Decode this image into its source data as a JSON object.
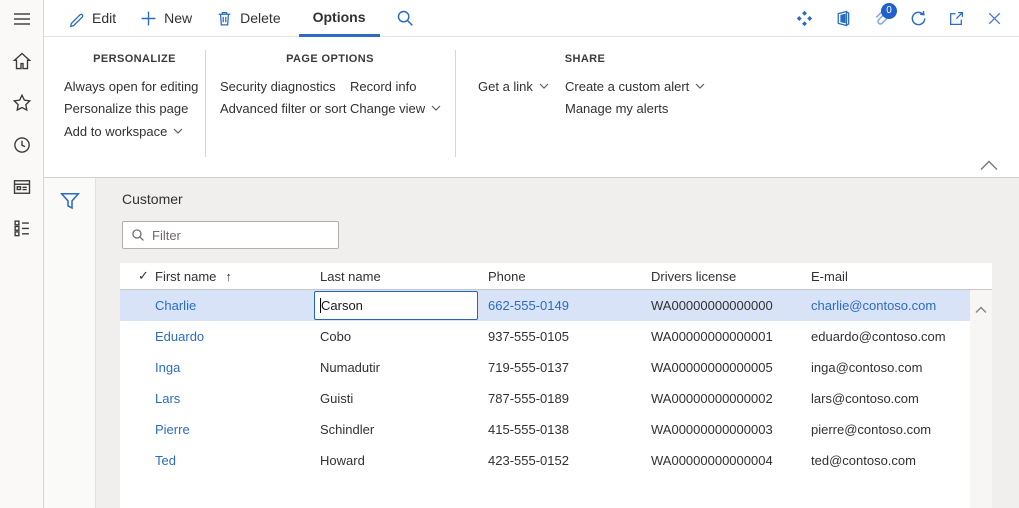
{
  "colors": {
    "accent": "#2b6cc3",
    "link": "#2b6cc3",
    "selected_row_bg": "#d8e3f8",
    "badge": "#2160c8"
  },
  "sidebar": {
    "icons": [
      "hamburger-menu",
      "home",
      "favorites",
      "recent",
      "page",
      "modules"
    ]
  },
  "command_bar": {
    "edit": "Edit",
    "new": "New",
    "delete": "Delete",
    "options_tab": "Options",
    "attachments_count": "0",
    "right_icons": [
      "diamond-grid",
      "office",
      "attachments",
      "refresh",
      "open-in-new-window",
      "close"
    ]
  },
  "ribbon": {
    "sections": [
      {
        "title": "PERSONALIZE",
        "columns": [
          [
            {
              "label": "Always open for editing"
            },
            {
              "label": "Personalize this page"
            },
            {
              "label": "Add to workspace",
              "chevron": true
            }
          ]
        ]
      },
      {
        "title": "PAGE OPTIONS",
        "columns": [
          [
            {
              "label": "Security diagnostics"
            },
            {
              "label": "Advanced filter or sort"
            }
          ],
          [
            {
              "label": "Record info"
            },
            {
              "label": "Change view",
              "chevron": true
            }
          ]
        ]
      },
      {
        "title": "SHARE",
        "columns": [
          [
            {
              "label": "Get a link",
              "chevron": true
            }
          ],
          [
            {
              "label": "Create a custom alert",
              "chevron": true
            },
            {
              "label": "Manage my alerts"
            }
          ]
        ]
      }
    ]
  },
  "page": {
    "title": "Customer",
    "filter_placeholder": "Filter"
  },
  "grid": {
    "columns": [
      "First name",
      "Last name",
      "Phone",
      "Drivers license",
      "E-mail"
    ],
    "sorted_column": "First name",
    "sort_direction": "ascending",
    "sort_arrow": "↑",
    "select_all_glyph": "✓",
    "rows": [
      {
        "first_name": "Charlie",
        "last_name": "Carson",
        "phone": "662-555-0149",
        "drivers_license": "WA00000000000000",
        "email": "charlie@contoso.com",
        "selected": true,
        "editing": "last_name"
      },
      {
        "first_name": "Eduardo",
        "last_name": "Cobo",
        "phone": "937-555-0105",
        "drivers_license": "WA00000000000001",
        "email": "eduardo@contoso.com"
      },
      {
        "first_name": "Inga",
        "last_name": "Numadutir",
        "phone": "719-555-0137",
        "drivers_license": "WA00000000000005",
        "email": "inga@contoso.com"
      },
      {
        "first_name": "Lars",
        "last_name": "Guisti",
        "phone": "787-555-0189",
        "drivers_license": "WA00000000000002",
        "email": "lars@contoso.com"
      },
      {
        "first_name": "Pierre",
        "last_name": "Schindler",
        "phone": "415-555-0138",
        "drivers_license": "WA00000000000003",
        "email": "pierre@contoso.com"
      },
      {
        "first_name": "Ted",
        "last_name": "Howard",
        "phone": "423-555-0152",
        "drivers_license": "WA00000000000004",
        "email": "ted@contoso.com"
      }
    ]
  }
}
